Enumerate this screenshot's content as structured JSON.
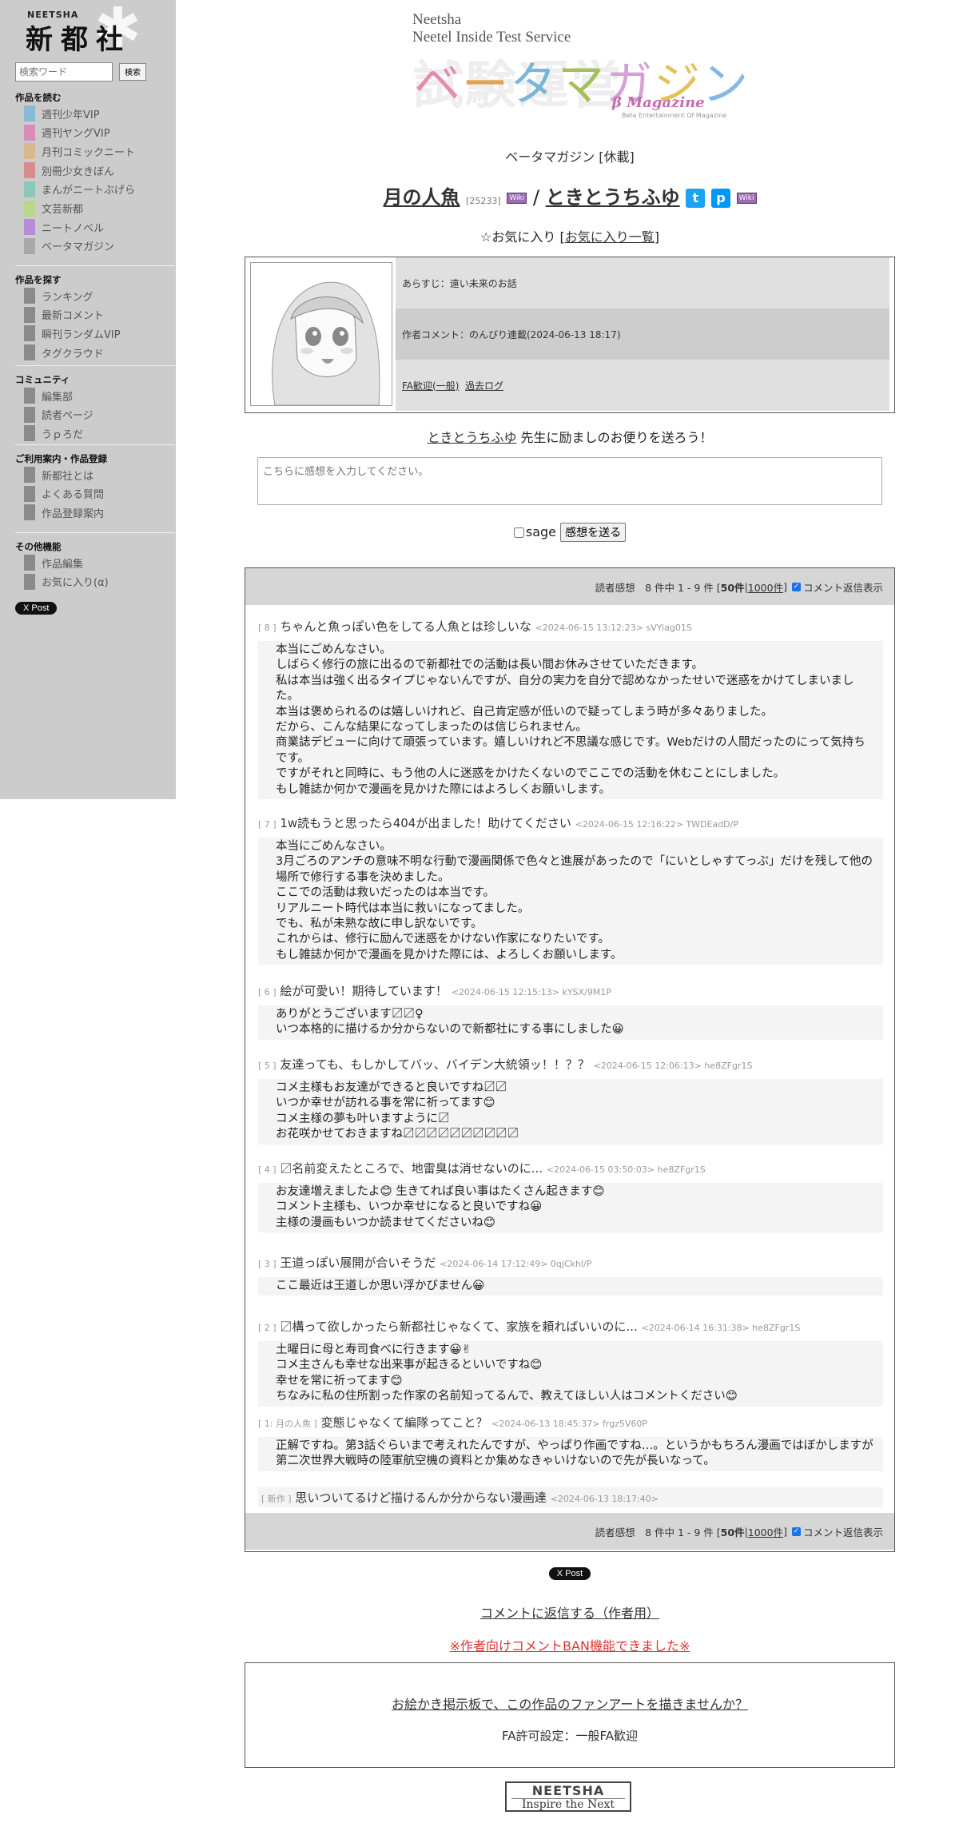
{
  "sidebar": {
    "logo_small": "NEETSHA",
    "logo_big": "新都社",
    "search_placeholder": "検索ワード",
    "search_button": "検索",
    "sections": [
      {
        "title": "作品を読む",
        "items": [
          {
            "label": "週刊少年VIP",
            "color": "#8cb8d8"
          },
          {
            "label": "週刊ヤングVIP",
            "color": "#d88cb8"
          },
          {
            "label": "月刊コミックニート",
            "color": "#d8b88c"
          },
          {
            "label": "別冊少女きぼん",
            "color": "#d88c8c"
          },
          {
            "label": "まんがニートぶげら",
            "color": "#8cc8b8"
          },
          {
            "label": "文芸新都",
            "color": "#b8d88c"
          },
          {
            "label": "ニートノベル",
            "color": "#b88cd8"
          },
          {
            "label": "ベータマガジン",
            "color": "#a8a8a8"
          }
        ]
      },
      {
        "title": "作品を探す",
        "items": [
          {
            "label": "ランキング",
            "color": "#8a8a8a"
          },
          {
            "label": "最新コメント",
            "color": "#8a8a8a"
          },
          {
            "label": "瞬刊ランダムVIP",
            "color": "#8a8a8a"
          },
          {
            "label": "タグクラウド",
            "color": "#8a8a8a"
          }
        ]
      },
      {
        "title": "コミュニティ",
        "items": [
          {
            "label": "編集部",
            "color": "#8a8a8a"
          },
          {
            "label": "読者ページ",
            "color": "#8a8a8a"
          },
          {
            "label": "うｐろだ",
            "color": "#8a8a8a"
          }
        ]
      },
      {
        "title": "ご利用案内・作品登録",
        "items": [
          {
            "label": "新都社とは",
            "color": "#8a8a8a"
          },
          {
            "label": "よくある質問",
            "color": "#8a8a8a"
          },
          {
            "label": "作品登録案内",
            "color": "#8a8a8a"
          }
        ]
      },
      {
        "title": "その他機能",
        "items": [
          {
            "label": "作品編集",
            "color": "#8a8a8a"
          },
          {
            "label": "お気に入り(α)",
            "color": "#8a8a8a"
          }
        ]
      }
    ],
    "x_post": "X Post"
  },
  "brand": {
    "line1": "Neetsha",
    "line2": "Neetel Inside Test Service",
    "ghost": "試験運営",
    "logo": [
      "ベ",
      "ー",
      "タ",
      "マ",
      "ガ",
      "ジ",
      "ン"
    ],
    "sub": "β Magazine",
    "tiny": "Beta Entertainment Of Magazine"
  },
  "work": {
    "magazine": "ベータマガジン [休載]",
    "title": "月の人魚",
    "id": "[25233]",
    "wiki": "Wiki",
    "separator": "/",
    "author": "ときとうちふゆ",
    "fav_star": "☆お気に入り [",
    "fav_link": "お気に入り一覧",
    "fav_end": "]",
    "synopsis": "あらすじ：遠い未来のお話",
    "author_comment": "作者コメント：のんびり連載(2024-06-13 18:17)",
    "fa_link": "FA歓迎(一般)",
    "past_log": "過去ログ"
  },
  "cheer": {
    "author": "ときとうちふゆ",
    "text": " 先生に励ましのお便りを送ろう！"
  },
  "form": {
    "placeholder": "こちらに感想を入力してください。",
    "sage": "sage",
    "send": "感想を送る"
  },
  "comments": {
    "bar_prefix": "読者感想　8 件中 1 - 9 件 [ ",
    "bar_50": "50件",
    "bar_mid": " | ",
    "bar_1000": "1000件",
    "bar_end": " ]",
    "bar_toggle": "コメント返信表示",
    "items": [
      {
        "num": "[ 8 ]",
        "title": "ちゃんと魚っぽい色をしてる人魚とは珍しいな",
        "meta": "<2024-06-15 13:12:23> sVYiag01S",
        "reply": "本当にごめんなさい。\nしばらく修行の旅に出るので新都社での活動は長い間お休みさせていただきます。\n私は本当は強く出るタイプじゃないんですが、自分の実力を自分で認めなかったせいで迷惑をかけてしまいました。\n本当は褒められるのは嬉しいけれど、自己肯定感が低いので疑ってしまう時が多々ありました。\nだから、こんな結果になってしまったのは信じられません。\n商業誌デビューに向けて頑張っています。嬉しいけれど不思議な感じです。Webだけの人間だったのにって気持ちです。\nですがそれと同時に、もう他の人に迷惑をかけたくないのでここでの活動を休むことにしました。\nもし雑誌か何かで漫画を見かけた際にはよろしくお願いします。"
      },
      {
        "num": "[ 7 ]",
        "title": "1w読もうと思ったら404が出ました！助けてください",
        "meta": "<2024-06-15 12:16:22> TWDEadD/P",
        "reply": "本当にごめんなさい。\n3月ごろのアンチの意味不明な行動で漫画関係で色々と進展があったので「にいとしゃすてっぷ」だけを残して他の場所で修行する事を決めました。\nここでの活動は救いだったのは本当です。\nリアルニート時代は本当に救いになってました。\nでも、私が未熟な故に申し訳ないです。\nこれからは、修行に励んで迷惑をかけない作家になりたいです。\nもし雑誌か何かで漫画を見かけた際には、よろしくお願いします。"
      },
      {
        "num": "[ 6 ]",
        "title": "絵が可愛い！期待しています！",
        "meta": "<2024-06-15 12:15:13> kYSX/9M1P",
        "reply": "ありがとうございます〼〼♀\nいつ本格的に描けるか分からないので新都社にする事にしました😀"
      },
      {
        "num": "[ 5 ]",
        "title": "友達っても、もしかしてバッ、バイデン大統領ッ！！？？",
        "meta": "<2024-06-15 12:06:13> he8ZFgr1S",
        "reply": "コメ主様もお友達ができると良いですね〼〼\nいつか幸せが訪れる事を常に祈ってます😊\nコメ主様の夢も叶いますように〼\nお花咲かせておきますね〼〼〼〼〼〼〼〼〼〼"
      },
      {
        "num": "[ 4 ]",
        "title": "〼名前変えたところで、地雷臭は消せないのに...",
        "meta": "<2024-06-15 03:50:03> he8ZFgr1S",
        "reply": "お友達増えましたよ😊 生きてれば良い事はたくさん起きます😊\nコメント主様も、いつか幸せになると良いですね😀\n主様の漫画もいつか読ませてくださいね😊"
      },
      {
        "num": "[ 3 ]",
        "title": "王道っぽい展開が合いそうだ",
        "meta": "<2024-06-14 17:12:49> 0qjCkhl/P",
        "reply": "ここ最近は王道しか思い浮かびません😀"
      },
      {
        "num": "[ 2 ]",
        "title": "〼構って欲しかったら新都社じゃなくて、家族を頼ればいいのに...",
        "meta": "<2024-06-14 16:31:38> he8ZFgr1S",
        "reply": "土曜日に母と寿司食べに行きます😀✌\nコメ主さんも幸せな出来事が起きるといいですね😊\n幸せを常に祈ってます😊\nちなみに私の住所割った作家の名前知ってるんで、教えてほしい人はコメントください😊"
      },
      {
        "num": "[ 1: 月の人魚 ]",
        "title": "変態じゃなくて編隊ってこと？",
        "meta": "<2024-06-13 18:45:37> frgz5V60P",
        "reply": "正解ですね。第3話ぐらいまで考えれたんですが、やっぱり作画ですね…。というかもちろん漫画ではぼかしますが第二次世界大戦時の陸軍航空機の資料とか集めなきゃいけないので先が長いなって。"
      },
      {
        "num": "[ 新作 ]",
        "title": "思いついてるけど描けるんか分からない漫画達",
        "meta": "<2024-06-13 18:17:40>",
        "reply": ""
      }
    ]
  },
  "footer": {
    "x_post": "X Post",
    "reply_link": "コメントに返信する（作者用）",
    "ban_link": "※作者向けコメントBAN機能できました※",
    "fa_question": "お絵かき掲示板で、この作品のファンアートを描きませんか？",
    "fa_setting": "FA許可設定：一般FA歓迎",
    "logo_top": "NEETSHA",
    "logo_bottom": "Inspire the Next"
  },
  "colors": {
    "sidebar_bg": "#cccccc",
    "twitter": "#1da1f2",
    "pixiv": "#0096fa",
    "wiki": "#9a6bb0",
    "ban": "#dd3333"
  }
}
